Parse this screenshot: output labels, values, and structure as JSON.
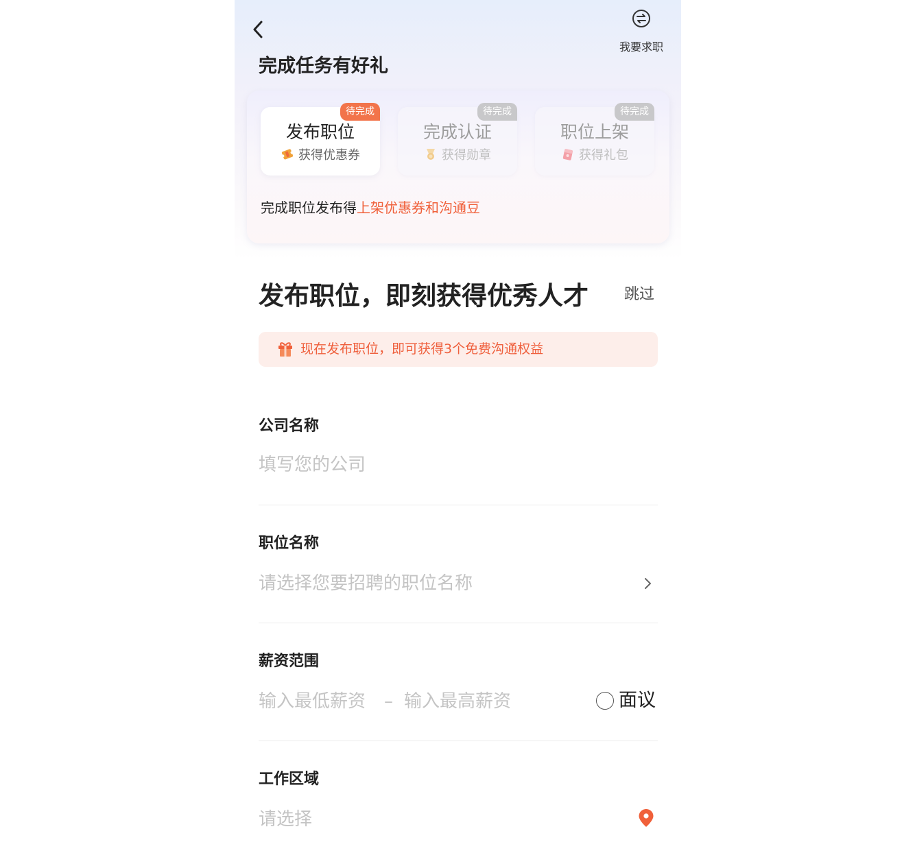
{
  "header": {
    "back_icon": "chevron-left-icon",
    "switch_icon": "switch-arrows-icon",
    "switch_label": "我要求职"
  },
  "task_section": {
    "title": "完成任务有好礼",
    "tasks": [
      {
        "name": "发布职位",
        "reward": "获得优惠券",
        "status": "待完成",
        "reward_icon": "coupon-icon",
        "active": true
      },
      {
        "name": "完成认证",
        "reward": "获得勋章",
        "status": "待完成",
        "reward_icon": "medal-icon",
        "active": false
      },
      {
        "name": "职位上架",
        "reward": "获得礼包",
        "status": "待完成",
        "reward_icon": "gift-bag-icon",
        "active": false
      }
    ],
    "hint_prefix": "完成职位发布得",
    "hint_highlight": "上架优惠券和沟通豆"
  },
  "form": {
    "headline": "发布职位，即刻获得优秀人才",
    "skip_label": "跳过",
    "promo": {
      "icon": "gift-icon",
      "text": "现在发布职位，即可获得3个免费沟通权益"
    },
    "company": {
      "label": "公司名称",
      "placeholder": "填写您的公司"
    },
    "position": {
      "label": "职位名称",
      "placeholder": "请选择您要招聘的职位名称"
    },
    "salary": {
      "label": "薪资范围",
      "min_placeholder": "输入最低薪资",
      "separator": "–",
      "max_placeholder": "输入最高薪资",
      "negotiable_label": "面议",
      "negotiable_checked": false
    },
    "area": {
      "label": "工作区域",
      "placeholder": "请选择"
    }
  },
  "colors": {
    "accent": "#f0603a",
    "badge_active": "#f2744b",
    "badge_inactive": "#c8c8ca",
    "promo_bg": "#fdeeea",
    "placeholder": "#c4c4c4"
  }
}
